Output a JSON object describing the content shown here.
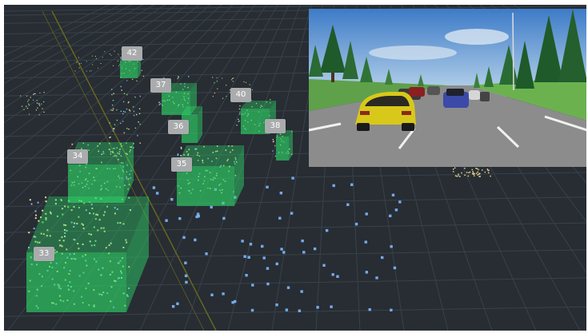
{
  "viewer": {
    "background": "#272d33",
    "grid_color": "#3a4149",
    "lane_color": "#6b6a1e",
    "box_color": "#2ee06a",
    "point_colors": [
      "#e8d48a",
      "#7fb8ff",
      "#7ee07e",
      "#e8e0a0"
    ]
  },
  "boxes": [
    {
      "id": "33",
      "label": "33"
    },
    {
      "id": "34",
      "label": "34"
    },
    {
      "id": "35",
      "label": "35"
    },
    {
      "id": "36",
      "label": "36"
    },
    {
      "id": "37",
      "label": "37"
    },
    {
      "id": "38",
      "label": "38"
    },
    {
      "id": "40",
      "label": "40"
    },
    {
      "id": "42",
      "label": "42"
    }
  ],
  "camera": {
    "sky_top": "#3d7bc7",
    "sky_bottom": "#bcd6ec",
    "road_color": "#8c8c8c",
    "grass_color": "#5fa14a",
    "ego_car_color": "#d8c81a"
  }
}
